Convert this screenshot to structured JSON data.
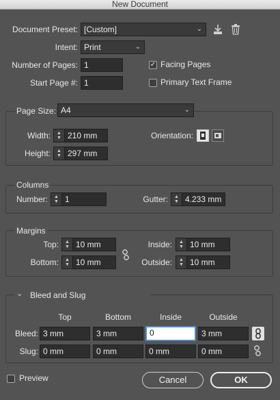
{
  "window": {
    "title": "New Document"
  },
  "document": {
    "preset_label": "Document Preset:",
    "preset_value": "[Custom]",
    "intent_label": "Intent:",
    "intent_value": "Print",
    "pages_label": "Number of Pages:",
    "pages_value": "1",
    "start_label": "Start Page #:",
    "start_value": "1",
    "facing_label": "Facing Pages",
    "facing_checked": true,
    "primary_label": "Primary Text Frame",
    "primary_checked": false
  },
  "page_size": {
    "label": "Page Size:",
    "value": "A4",
    "width_label": "Width:",
    "width_value": "210 mm",
    "height_label": "Height:",
    "height_value": "297 mm",
    "orientation_label": "Orientation:"
  },
  "columns": {
    "title": "Columns",
    "number_label": "Number:",
    "number_value": "1",
    "gutter_label": "Gutter:",
    "gutter_value": "4.233 mm"
  },
  "margins": {
    "title": "Margins",
    "top_label": "Top:",
    "top_value": "10 mm",
    "bottom_label": "Bottom:",
    "bottom_value": "10 mm",
    "inside_label": "Inside:",
    "inside_value": "10 mm",
    "outside_label": "Outside:",
    "outside_value": "10 mm"
  },
  "bleed_slug": {
    "title": "Bleed and Slug",
    "headers": [
      "Top",
      "Bottom",
      "Inside",
      "Outside"
    ],
    "bleed_label": "Bleed:",
    "bleed_values": [
      "3 mm",
      "3 mm",
      "0",
      "3 mm"
    ],
    "slug_label": "Slug:",
    "slug_values": [
      "0 mm",
      "0 mm",
      "0 mm",
      "0 mm"
    ]
  },
  "footer": {
    "preview_label": "Preview",
    "cancel_label": "Cancel",
    "ok_label": "OK"
  }
}
